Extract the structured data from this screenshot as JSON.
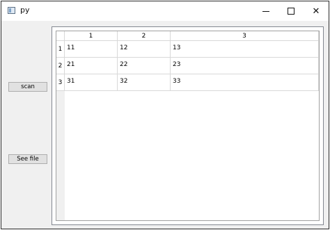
{
  "window": {
    "title": "py",
    "close_glyph": "✕"
  },
  "buttons": {
    "scan_label": "scan",
    "see_file_label": "See file"
  },
  "table": {
    "column_headers": [
      "1",
      "2",
      "3"
    ],
    "row_headers": [
      "1",
      "2",
      "3"
    ],
    "rows": [
      [
        "11",
        "12",
        "13"
      ],
      [
        "21",
        "22",
        "23"
      ],
      [
        "31",
        "32",
        "33"
      ]
    ]
  }
}
